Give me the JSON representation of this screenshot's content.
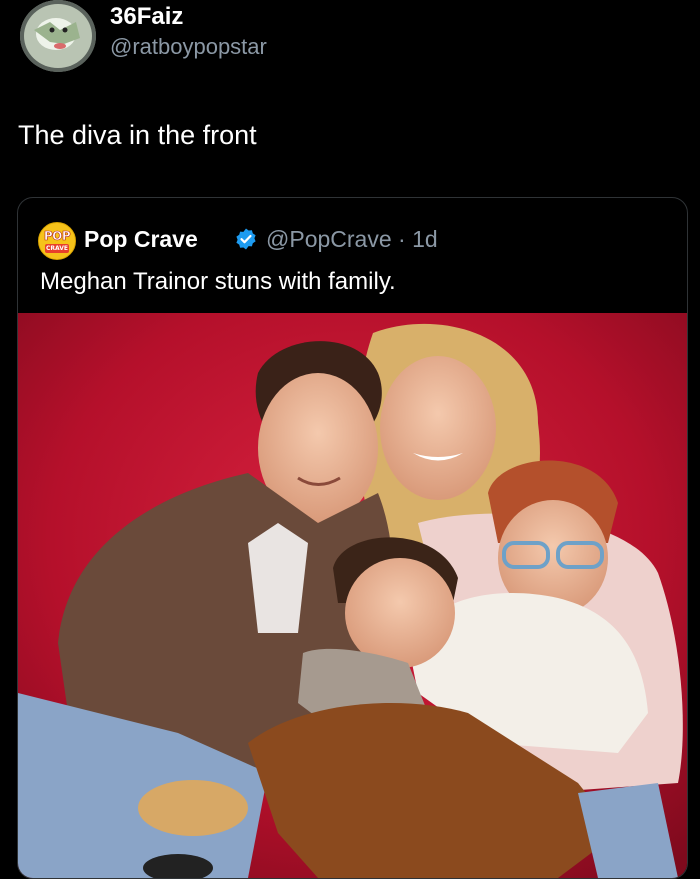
{
  "post": {
    "author": {
      "display_name": "36Faiz",
      "handle": "@ratboypopstar",
      "avatar_icon": "avatar-image"
    },
    "text": "The diva in the front"
  },
  "quoted_post": {
    "author": {
      "display_name": "Pop Crave",
      "handle": "@PopCrave",
      "time": "· 1d",
      "logo_text_top": "POP",
      "logo_text_bottom": "CRAVE",
      "verified_icon": "verified-badge-icon"
    },
    "text": "Meghan Trainor stuns with family.",
    "media": {
      "icon": "family-photo"
    }
  },
  "colors": {
    "background": "#000000",
    "text_primary": "#ffffff",
    "text_secondary": "#8b98a5",
    "card_border": "#2f3336",
    "verified": "#1d9bf0",
    "photo_backdrop": "#c3122e"
  }
}
